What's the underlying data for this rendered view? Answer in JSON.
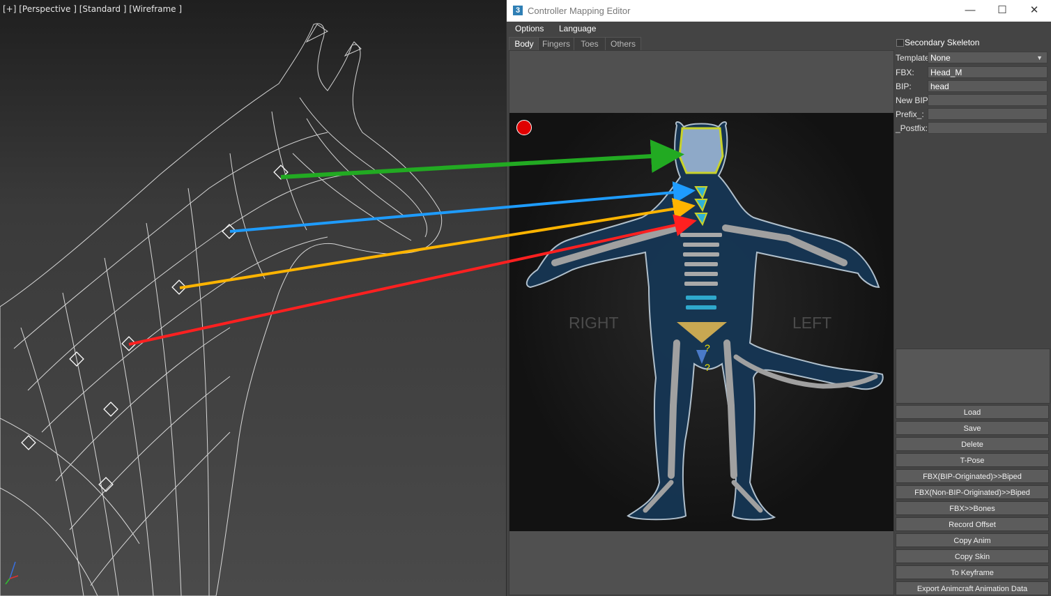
{
  "viewport": {
    "label": "[+] [Perspective ] [Standard ] [Wireframe ]"
  },
  "window": {
    "title": "Controller Mapping Editor",
    "app_icon_glyph": "3",
    "controls": {
      "minimize": "—",
      "maximize": "☐",
      "close": "✕"
    }
  },
  "menu": [
    "Options",
    "Language"
  ],
  "tabs": [
    {
      "label": "Body",
      "active": true
    },
    {
      "label": "Fingers",
      "active": false
    },
    {
      "label": "Toes",
      "active": false
    },
    {
      "label": "Others",
      "active": false
    }
  ],
  "canvas": {
    "side_right": "RIGHT",
    "side_left": "LEFT",
    "unknown_marker_1": "?",
    "unknown_marker_2": "?",
    "record_indicator_color": "#e00000"
  },
  "options": {
    "secondary_skeleton_label": "Secondary Skeleton",
    "secondary_skeleton_checked": false
  },
  "fields": {
    "template": {
      "label": "Template",
      "value": "None"
    },
    "fbx": {
      "label": "FBX:",
      "value": "Head_M"
    },
    "bip": {
      "label": "BIP:",
      "value": "head"
    },
    "new_bip": {
      "label": "New BIP:",
      "value": ""
    },
    "prefix": {
      "label": "Prefix_:",
      "value": ""
    },
    "postfix": {
      "label": "_Postfix:",
      "value": ""
    }
  },
  "buttons": {
    "load": "Load",
    "save": "Save",
    "delete": "Delete",
    "tpose": "T-Pose",
    "fbx_bip_orig": "FBX(BIP-Originated)>>Biped",
    "fbx_nonbip_orig": "FBX(Non-BIP-Originated)>>Biped",
    "fbx_bones": "FBX>>Bones",
    "record_offset": "Record Offset",
    "copy_anim": "Copy Anim",
    "copy_skin": "Copy Skin",
    "to_keyframe": "To Keyframe",
    "export": "Export Animcraft Animation Data"
  },
  "colors": {
    "arrow_head": "#22aa22",
    "arrow_neck1": "#1e9cff",
    "arrow_neck2": "#ffb400",
    "arrow_neck3": "#ff2020",
    "skeleton_body": "#163654",
    "highlight": "#c8d22a",
    "pelvis": "#c8a852"
  }
}
